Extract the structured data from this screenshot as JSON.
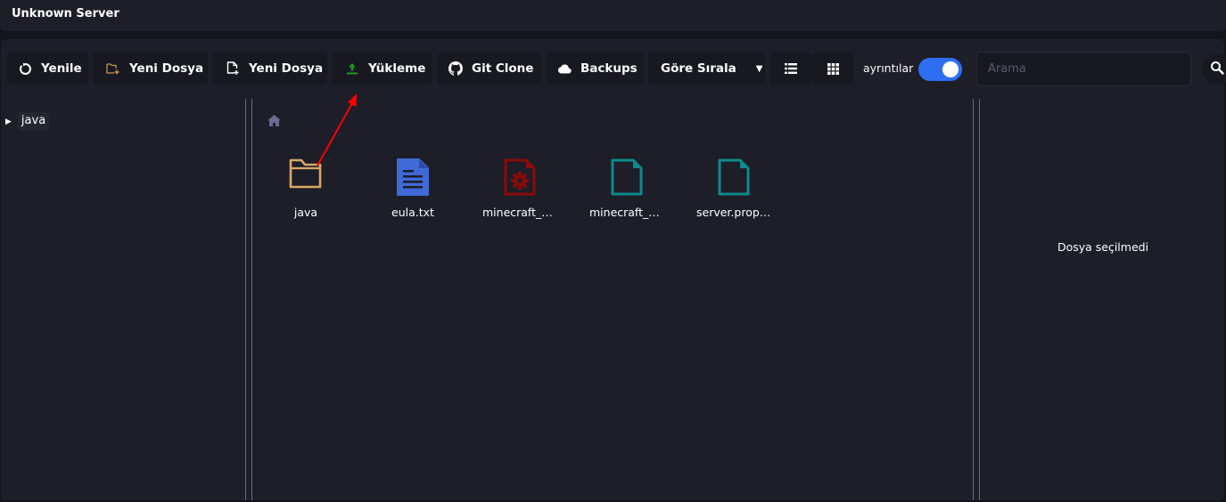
{
  "window": {
    "title": "Unknown Server"
  },
  "toolbar": {
    "buttons": [
      {
        "id": "refresh",
        "label": "Yenile",
        "icon": "refresh-icon"
      },
      {
        "id": "new-folder",
        "label": "Yeni Dosya",
        "icon": "folder-plus-icon"
      },
      {
        "id": "new-file",
        "label": "Yeni Dosya",
        "icon": "file-plus-icon"
      },
      {
        "id": "upload",
        "label": "Yükleme",
        "icon": "upload-icon"
      },
      {
        "id": "git-clone",
        "label": "Git Clone",
        "icon": "github-icon"
      },
      {
        "id": "backups",
        "label": "Backups",
        "icon": "cloud-icon"
      }
    ],
    "sort": {
      "label": "Göre Sırala",
      "icon": "caret-down-icon"
    },
    "view_list_icon": "list-view-icon",
    "view_grid_icon": "grid-view-icon",
    "details_toggle": {
      "label": "ayrıntılar",
      "on": true
    },
    "search": {
      "placeholder": "Arama",
      "value": ""
    },
    "search_icon": "search-icon"
  },
  "sidebar": {
    "tree": [
      {
        "label": "java",
        "expanded": false
      }
    ]
  },
  "breadcrumb": {
    "icon": "home-icon"
  },
  "files": [
    {
      "name": "java",
      "type": "folder",
      "color": "#d9a866"
    },
    {
      "name": "eula.txt",
      "type": "text",
      "color": "#3f6ad8"
    },
    {
      "name": "minecraft_s...",
      "type": "config",
      "color": "#8b0a0a"
    },
    {
      "name": "minecraft_s...",
      "type": "file",
      "color": "#0e8a8a"
    },
    {
      "name": "server.prope...",
      "type": "file",
      "color": "#0e8a8a"
    }
  ],
  "details": {
    "empty_text": "Dosya seçilmedi"
  },
  "colors": {
    "accent": "#2e6ff2",
    "annotation_arrow": "#ff0000",
    "upload_icon": "#1e9a1e",
    "folder_icon": "#c89550"
  }
}
